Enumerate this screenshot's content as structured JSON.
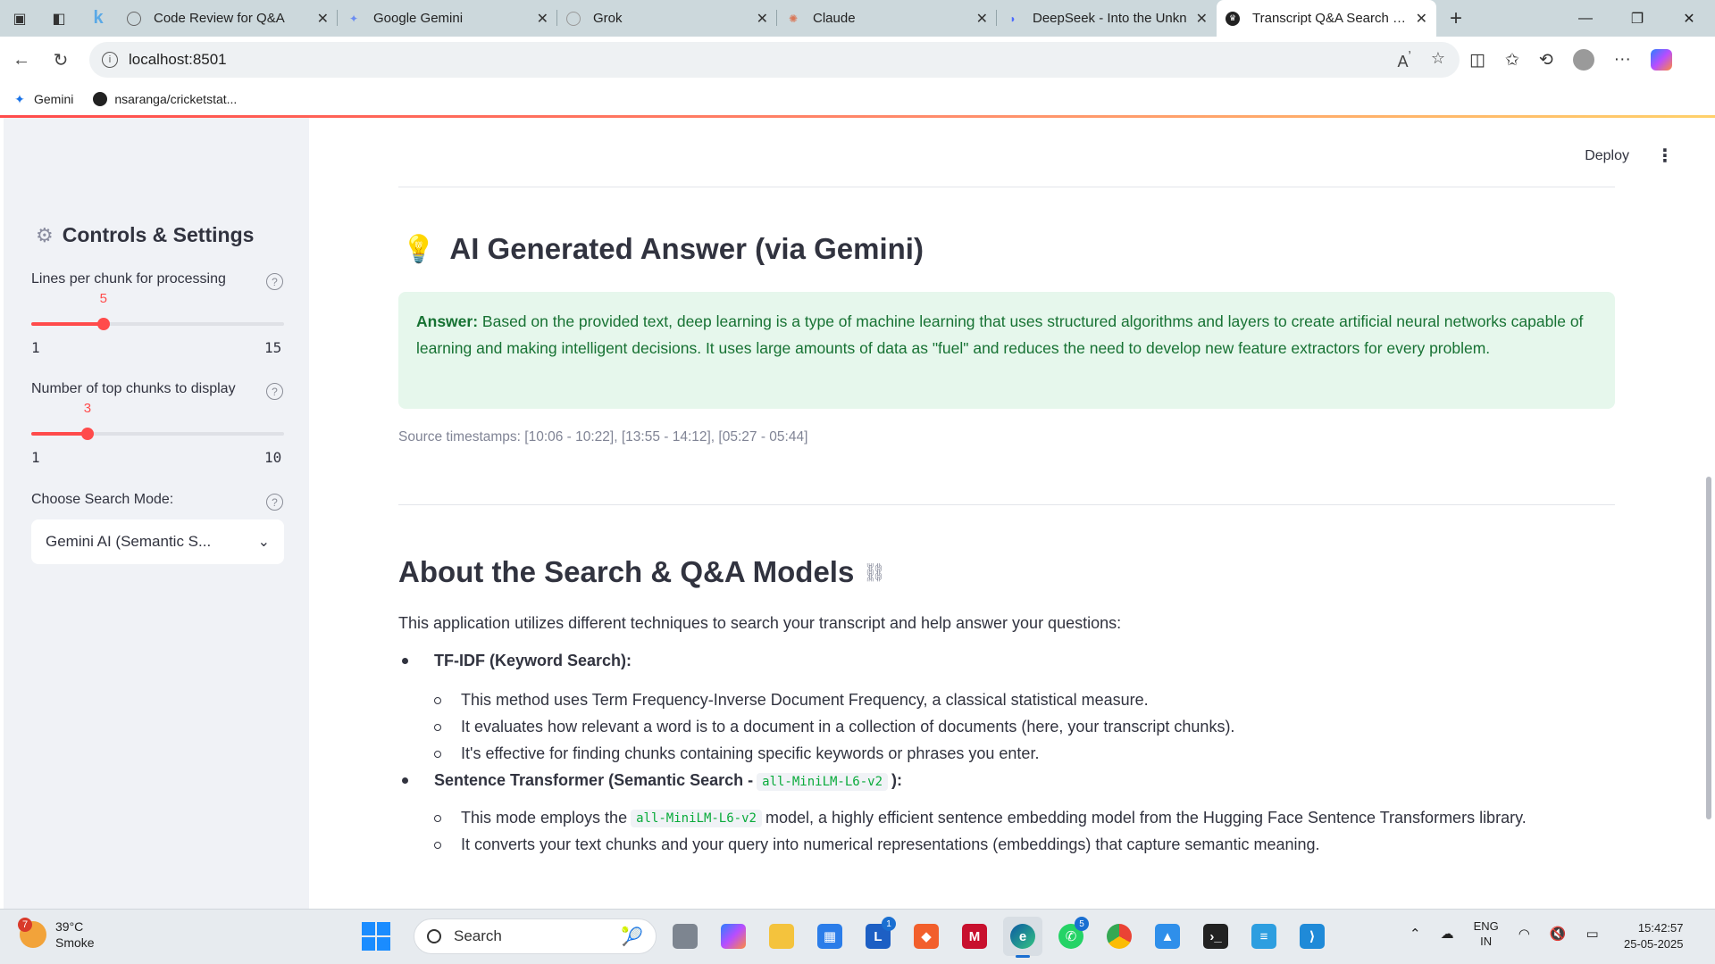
{
  "browser": {
    "tabs": [
      {
        "title": "Code Review for Q&A",
        "active": false
      },
      {
        "title": "Google Gemini",
        "active": false
      },
      {
        "title": "Grok",
        "active": false
      },
      {
        "title": "Claude",
        "active": false
      },
      {
        "title": "DeepSeek - Into the Unkn",
        "active": false
      },
      {
        "title": "Transcript Q&A Search En",
        "active": true
      }
    ],
    "url": "localhost:8501",
    "bookmarks": [
      "Gemini",
      "nsaranga/cricketstat..."
    ]
  },
  "app": {
    "deploy_label": "Deploy",
    "sidebar": {
      "title": "Controls & Settings",
      "lines_per_chunk": {
        "label": "Lines per chunk for processing",
        "value": "5",
        "min": "1",
        "max": "15",
        "fraction": 0.2857
      },
      "top_chunks": {
        "label": "Number of top chunks to display",
        "value": "3",
        "min": "1",
        "max": "10",
        "fraction": 0.2222
      },
      "search_mode": {
        "label": "Choose Search Mode:",
        "value": "Gemini AI (Semantic S..."
      }
    },
    "answer": {
      "heading": "AI Generated Answer (via Gemini)",
      "prefix": "Answer:",
      "text": "Based on the provided text, deep learning is a type of machine learning that uses structured algorithms and layers to create artificial neural networks capable of learning and making intelligent decisions. It uses large amounts of data as \"fuel\" and reduces the need to develop new feature extractors for every problem.",
      "sources": "Source timestamps: [10:06 - 10:22], [13:55 - 14:12], [05:27 - 05:44]"
    },
    "about": {
      "heading": "About the Search & Q&A Models",
      "intro": "This application utilizes different techniques to search your transcript and help answer your questions:",
      "tfidf_title": "TF-IDF (Keyword Search):",
      "tfidf_points": [
        "This method uses Term Frequency-Inverse Document Frequency, a classical statistical measure.",
        "It evaluates how relevant a word is to a document in a collection of documents (here, your transcript chunks).",
        "It's effective for finding chunks containing specific keywords or phrases you enter."
      ],
      "st_title_pre": "Sentence Transformer (Semantic Search -",
      "st_model": "all-MiniLM-L6-v2",
      "st_title_post": "):",
      "st_point1_pre": "This mode employs the",
      "st_point1_post": "model, a highly efficient sentence embedding model from the Hugging Face Sentence Transformers library.",
      "st_point2": "It converts your text chunks and your query into numerical representations (embeddings) that capture semantic meaning."
    }
  },
  "taskbar": {
    "weather_badge": "7",
    "temp": "39°C",
    "condition": "Smoke",
    "search_label": "Search",
    "lang1": "ENG",
    "lang2": "IN",
    "time": "15:42:57",
    "date": "25-05-2025",
    "badges": {
      "l_app": "1",
      "whatsapp": "5"
    }
  },
  "colors": {
    "accent": "#ff4b4b",
    "success_bg": "#e6f7ec",
    "success_text": "#177233"
  }
}
